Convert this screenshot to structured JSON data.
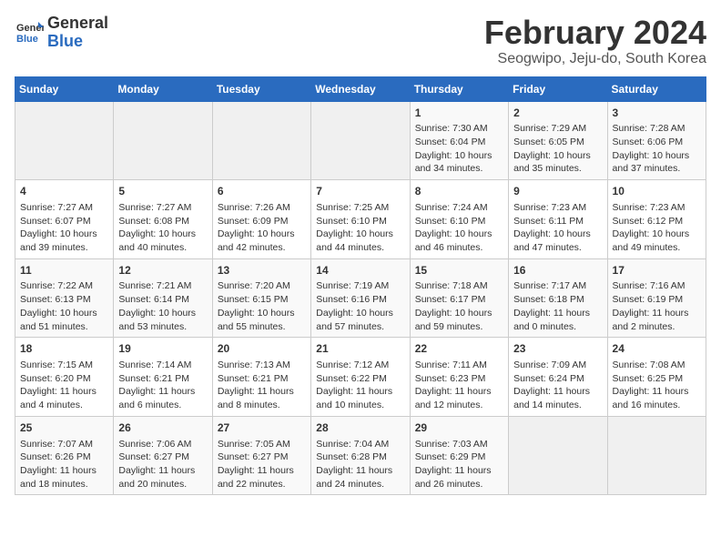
{
  "header": {
    "logo_general": "General",
    "logo_blue": "Blue",
    "month_title": "February 2024",
    "location": "Seogwipo, Jeju-do, South Korea"
  },
  "weekdays": [
    "Sunday",
    "Monday",
    "Tuesday",
    "Wednesday",
    "Thursday",
    "Friday",
    "Saturday"
  ],
  "weeks": [
    [
      {
        "day": "",
        "info": ""
      },
      {
        "day": "",
        "info": ""
      },
      {
        "day": "",
        "info": ""
      },
      {
        "day": "",
        "info": ""
      },
      {
        "day": "1",
        "info": "Sunrise: 7:30 AM\nSunset: 6:04 PM\nDaylight: 10 hours and 34 minutes."
      },
      {
        "day": "2",
        "info": "Sunrise: 7:29 AM\nSunset: 6:05 PM\nDaylight: 10 hours and 35 minutes."
      },
      {
        "day": "3",
        "info": "Sunrise: 7:28 AM\nSunset: 6:06 PM\nDaylight: 10 hours and 37 minutes."
      }
    ],
    [
      {
        "day": "4",
        "info": "Sunrise: 7:27 AM\nSunset: 6:07 PM\nDaylight: 10 hours and 39 minutes."
      },
      {
        "day": "5",
        "info": "Sunrise: 7:27 AM\nSunset: 6:08 PM\nDaylight: 10 hours and 40 minutes."
      },
      {
        "day": "6",
        "info": "Sunrise: 7:26 AM\nSunset: 6:09 PM\nDaylight: 10 hours and 42 minutes."
      },
      {
        "day": "7",
        "info": "Sunrise: 7:25 AM\nSunset: 6:10 PM\nDaylight: 10 hours and 44 minutes."
      },
      {
        "day": "8",
        "info": "Sunrise: 7:24 AM\nSunset: 6:10 PM\nDaylight: 10 hours and 46 minutes."
      },
      {
        "day": "9",
        "info": "Sunrise: 7:23 AM\nSunset: 6:11 PM\nDaylight: 10 hours and 47 minutes."
      },
      {
        "day": "10",
        "info": "Sunrise: 7:23 AM\nSunset: 6:12 PM\nDaylight: 10 hours and 49 minutes."
      }
    ],
    [
      {
        "day": "11",
        "info": "Sunrise: 7:22 AM\nSunset: 6:13 PM\nDaylight: 10 hours and 51 minutes."
      },
      {
        "day": "12",
        "info": "Sunrise: 7:21 AM\nSunset: 6:14 PM\nDaylight: 10 hours and 53 minutes."
      },
      {
        "day": "13",
        "info": "Sunrise: 7:20 AM\nSunset: 6:15 PM\nDaylight: 10 hours and 55 minutes."
      },
      {
        "day": "14",
        "info": "Sunrise: 7:19 AM\nSunset: 6:16 PM\nDaylight: 10 hours and 57 minutes."
      },
      {
        "day": "15",
        "info": "Sunrise: 7:18 AM\nSunset: 6:17 PM\nDaylight: 10 hours and 59 minutes."
      },
      {
        "day": "16",
        "info": "Sunrise: 7:17 AM\nSunset: 6:18 PM\nDaylight: 11 hours and 0 minutes."
      },
      {
        "day": "17",
        "info": "Sunrise: 7:16 AM\nSunset: 6:19 PM\nDaylight: 11 hours and 2 minutes."
      }
    ],
    [
      {
        "day": "18",
        "info": "Sunrise: 7:15 AM\nSunset: 6:20 PM\nDaylight: 11 hours and 4 minutes."
      },
      {
        "day": "19",
        "info": "Sunrise: 7:14 AM\nSunset: 6:21 PM\nDaylight: 11 hours and 6 minutes."
      },
      {
        "day": "20",
        "info": "Sunrise: 7:13 AM\nSunset: 6:21 PM\nDaylight: 11 hours and 8 minutes."
      },
      {
        "day": "21",
        "info": "Sunrise: 7:12 AM\nSunset: 6:22 PM\nDaylight: 11 hours and 10 minutes."
      },
      {
        "day": "22",
        "info": "Sunrise: 7:11 AM\nSunset: 6:23 PM\nDaylight: 11 hours and 12 minutes."
      },
      {
        "day": "23",
        "info": "Sunrise: 7:09 AM\nSunset: 6:24 PM\nDaylight: 11 hours and 14 minutes."
      },
      {
        "day": "24",
        "info": "Sunrise: 7:08 AM\nSunset: 6:25 PM\nDaylight: 11 hours and 16 minutes."
      }
    ],
    [
      {
        "day": "25",
        "info": "Sunrise: 7:07 AM\nSunset: 6:26 PM\nDaylight: 11 hours and 18 minutes."
      },
      {
        "day": "26",
        "info": "Sunrise: 7:06 AM\nSunset: 6:27 PM\nDaylight: 11 hours and 20 minutes."
      },
      {
        "day": "27",
        "info": "Sunrise: 7:05 AM\nSunset: 6:27 PM\nDaylight: 11 hours and 22 minutes."
      },
      {
        "day": "28",
        "info": "Sunrise: 7:04 AM\nSunset: 6:28 PM\nDaylight: 11 hours and 24 minutes."
      },
      {
        "day": "29",
        "info": "Sunrise: 7:03 AM\nSunset: 6:29 PM\nDaylight: 11 hours and 26 minutes."
      },
      {
        "day": "",
        "info": ""
      },
      {
        "day": "",
        "info": ""
      }
    ]
  ]
}
